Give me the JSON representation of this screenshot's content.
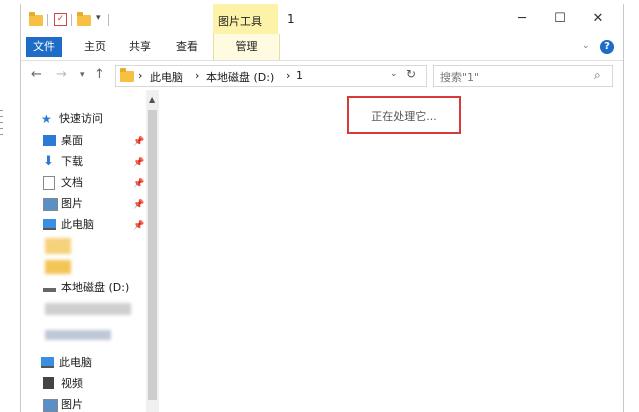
{
  "window": {
    "title": "1"
  },
  "ribbon": {
    "context_tab": "图片工具",
    "tabs": [
      "文件",
      "主页",
      "共享",
      "查看",
      "管理"
    ]
  },
  "address": {
    "crumbs": [
      "此电脑",
      "本地磁盘 (D:)",
      "1"
    ],
    "separator": "›"
  },
  "search": {
    "placeholder": "搜索\"1\""
  },
  "sidebar": {
    "quick_access": "快速访问",
    "pinned": [
      {
        "label": "桌面",
        "icon": "desktop-icon"
      },
      {
        "label": "下载",
        "icon": "download-icon"
      },
      {
        "label": "文档",
        "icon": "document-icon"
      },
      {
        "label": "图片",
        "icon": "picture-icon"
      },
      {
        "label": "此电脑",
        "icon": "computer-icon"
      }
    ],
    "drive": "本地磁盘 (D:)",
    "this_pc": "此电脑",
    "pc_items": [
      {
        "label": "视频",
        "icon": "video-icon"
      },
      {
        "label": "图片",
        "icon": "picture-icon"
      }
    ]
  },
  "content": {
    "status": "正在处理它..."
  },
  "colors": {
    "accent": "#1e6cc5",
    "highlight": "#d83a3a",
    "context_tab": "#fcf3a8"
  }
}
